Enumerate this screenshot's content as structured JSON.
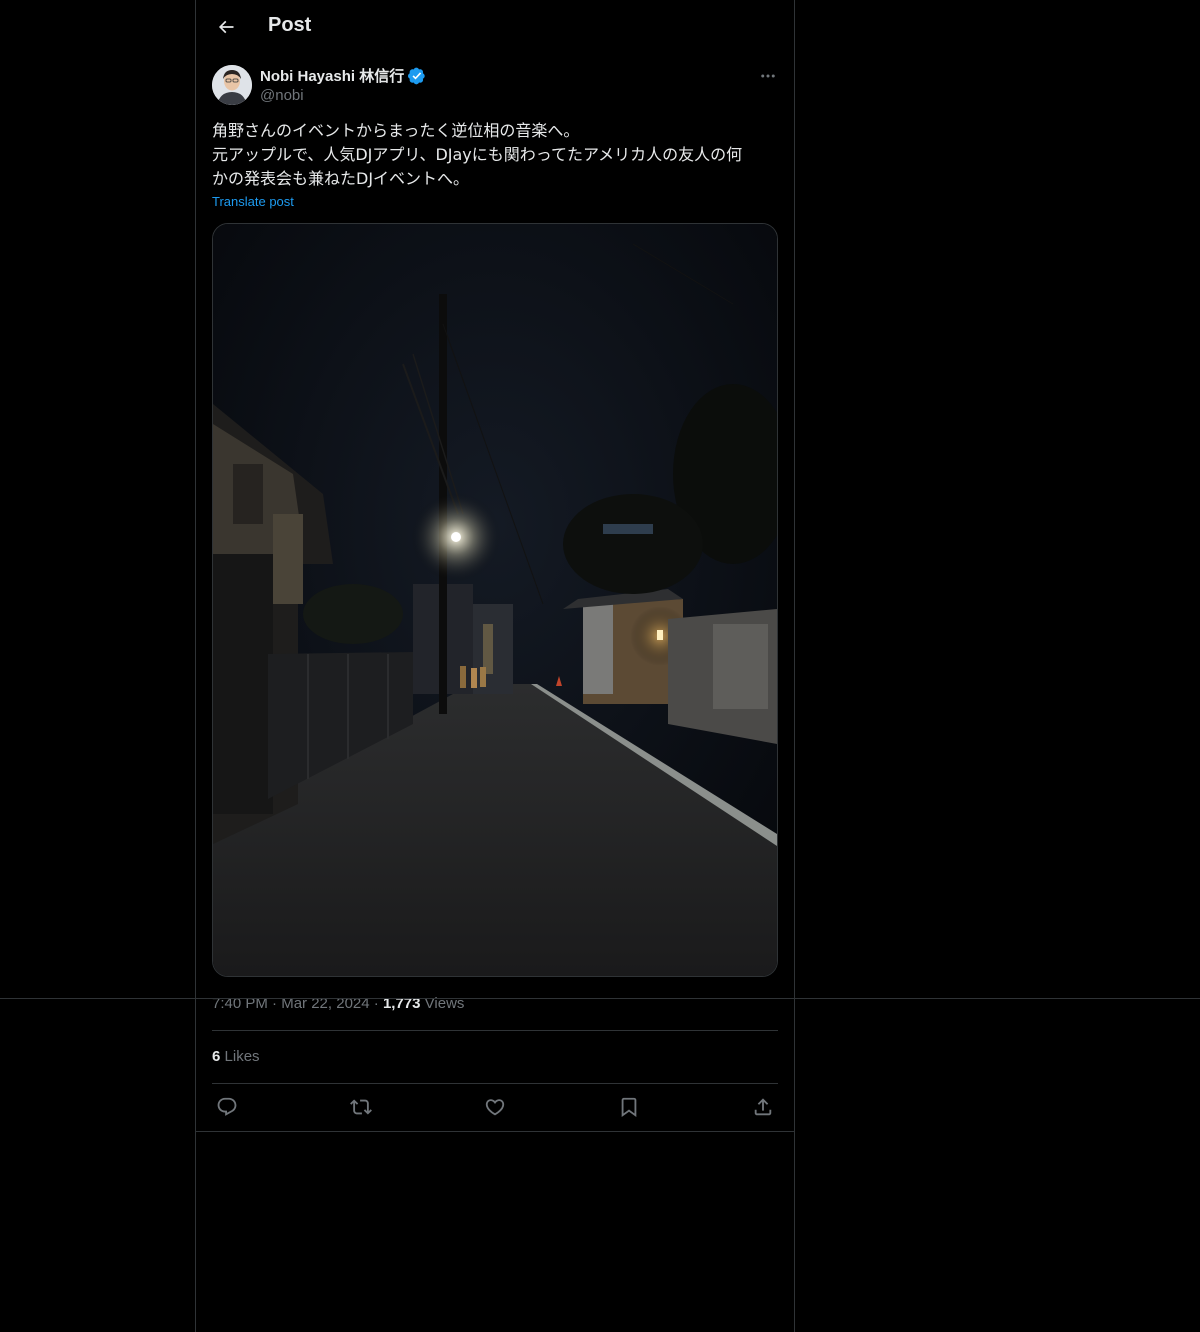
{
  "header": {
    "title": "Post",
    "back_icon": "arrow-left-icon"
  },
  "author": {
    "name": "Nobi Hayashi 林信行",
    "handle": "@nobi",
    "verified": true,
    "verified_color": "#1d9bf0"
  },
  "post": {
    "lines": [
      "角野さんのイベントからまったく逆位相の音楽へ。",
      "元アップルで、人気DJアプリ、DJayにも関わってたアメリカ人の友人の何",
      "かの発表会も兼ねたDJイベントへ。"
    ],
    "translate_label": "Translate post",
    "media_alt": "night street photo"
  },
  "meta": {
    "time": "7:40 PM",
    "date": "Mar 22, 2024",
    "views_count": "1,773",
    "views_label": "Views",
    "separator": "·"
  },
  "stats": {
    "likes_count": "6",
    "likes_label": "Likes"
  },
  "actions": [
    "reply-icon",
    "repost-icon",
    "like-icon",
    "bookmark-icon",
    "share-icon"
  ],
  "colors": {
    "background": "#000000",
    "border": "#2f3336",
    "text_primary": "#e7e9ea",
    "text_secondary": "#71767b",
    "accent": "#1d9bf0"
  }
}
